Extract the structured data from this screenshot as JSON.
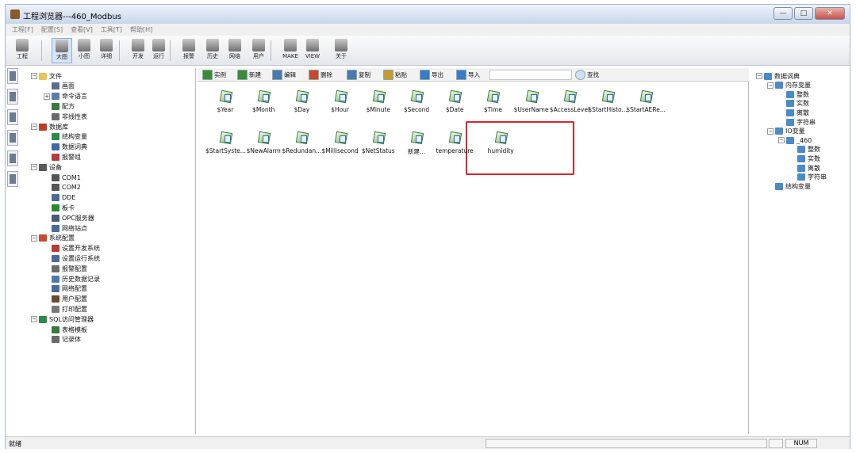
{
  "window": {
    "title": "工程浏览器---460_Modbus"
  },
  "menu": [
    "工程[F]",
    "配置[S]",
    "查看[V]",
    "工具[T]",
    "帮助[H]"
  ],
  "toolbar": [
    {
      "label": "工程",
      "icon": "project-icon"
    },
    {
      "label": "大图",
      "icon": "large-icon-view-icon",
      "active": true
    },
    {
      "label": "小图",
      "icon": "small-icon-view-icon"
    },
    {
      "label": "详细",
      "icon": "detail-view-icon"
    },
    {
      "label": "开发",
      "icon": "develop-icon"
    },
    {
      "label": "运行",
      "icon": "run-icon"
    },
    {
      "label": "报警",
      "icon": "alarm-icon"
    },
    {
      "label": "历史",
      "icon": "history-icon"
    },
    {
      "label": "网络",
      "icon": "network-icon"
    },
    {
      "label": "用户",
      "icon": "user-icon"
    },
    {
      "label": "MAKE",
      "icon": "make-icon"
    },
    {
      "label": "VIEW",
      "icon": "view-icon"
    },
    {
      "label": "关于",
      "icon": "about-icon"
    }
  ],
  "vertical_tabs": [
    "系统",
    "变量",
    "站点",
    "画面",
    "设备",
    "资源"
  ],
  "left_tree": [
    {
      "label": "文件",
      "level": 0,
      "toggle": "−",
      "icon": "folder-icon",
      "color": "#e8c45a"
    },
    {
      "label": "画面",
      "level": 1,
      "icon": "screen-icon",
      "color": "#5a6e8a"
    },
    {
      "label": "命令语言",
      "level": 1,
      "toggle": "+",
      "icon": "command-language-icon",
      "color": "#5a7ab0"
    },
    {
      "label": "配方",
      "level": 1,
      "icon": "recipe-icon",
      "color": "#3c7a3c"
    },
    {
      "label": "非线性表",
      "level": 1,
      "icon": "nonlinear-table-icon",
      "color": "#6a6a6a"
    },
    {
      "label": "数据库",
      "level": 0,
      "toggle": "−",
      "icon": "database-icon",
      "color": "#c03c2a"
    },
    {
      "label": "结构变量",
      "level": 1,
      "icon": "struct-variable-icon",
      "color": "#2e8a4a"
    },
    {
      "label": "数据词典",
      "level": 1,
      "icon": "data-dictionary-icon",
      "color": "#3a6aa8"
    },
    {
      "label": "报警组",
      "level": 1,
      "icon": "alarm-group-icon",
      "color": "#b83a3a"
    },
    {
      "label": "设备",
      "level": 0,
      "toggle": "−",
      "icon": "device-icon",
      "color": "#5a5a5a"
    },
    {
      "label": "COM1",
      "level": 1,
      "icon": "serial-port-icon",
      "color": "#555555"
    },
    {
      "label": "COM2",
      "level": 1,
      "icon": "serial-port-icon",
      "color": "#555555"
    },
    {
      "label": "DDE",
      "level": 1,
      "icon": "dde-icon",
      "color": "#4a6a9a"
    },
    {
      "label": "板卡",
      "level": 1,
      "icon": "board-card-icon",
      "color": "#2a8a2a"
    },
    {
      "label": "OPC服务器",
      "level": 1,
      "icon": "opc-server-icon",
      "color": "#4a5a7a"
    },
    {
      "label": "网络站点",
      "level": 1,
      "icon": "network-station-icon",
      "color": "#4a6a9a"
    },
    {
      "label": "系统配置",
      "level": 0,
      "toggle": "−",
      "icon": "system-config-icon",
      "color": "#c84a2a"
    },
    {
      "label": "设置开发系统",
      "level": 1,
      "icon": "dev-system-icon",
      "color": "#b83a3a"
    },
    {
      "label": "设置运行系统",
      "level": 1,
      "icon": "run-system-icon",
      "color": "#4a6a9a"
    },
    {
      "label": "报警配置",
      "level": 1,
      "icon": "alarm-config-icon",
      "color": "#6a6a6a"
    },
    {
      "label": "历史数据记录",
      "level": 1,
      "icon": "history-record-icon",
      "color": "#4a7ab0"
    },
    {
      "label": "网络配置",
      "level": 1,
      "icon": "network-config-icon",
      "color": "#4a6a9a"
    },
    {
      "label": "用户配置",
      "level": 1,
      "icon": "user-config-icon",
      "color": "#6a4a2a"
    },
    {
      "label": "打印配置",
      "level": 1,
      "icon": "print-config-icon",
      "color": "#7a7a7a"
    },
    {
      "label": "SQL访问管理器",
      "level": 0,
      "toggle": "−",
      "icon": "sql-manager-icon",
      "color": "#2a8a4a"
    },
    {
      "label": "表格模板",
      "level": 1,
      "icon": "table-template-icon",
      "color": "#3a7a3a"
    },
    {
      "label": "记录体",
      "level": 1,
      "icon": "record-icon",
      "color": "#6a6a6a"
    }
  ],
  "right_toolbar": [
    {
      "label": "实例",
      "icon": "instance-icon",
      "color": "#3a8a3a"
    },
    {
      "label": "新建",
      "icon": "new-icon",
      "color": "#3a8a3a"
    },
    {
      "label": "编辑",
      "icon": "edit-icon",
      "color": "#4a7ab0"
    },
    {
      "label": "删除",
      "icon": "delete-icon",
      "color": "#c84a2a"
    },
    {
      "label": "复制",
      "icon": "copy-icon",
      "color": "#4a7ab0"
    },
    {
      "label": "粘贴",
      "icon": "paste-icon",
      "color": "#c89a2a"
    },
    {
      "label": "导出",
      "icon": "export-icon",
      "color": "#3a7ac8"
    },
    {
      "label": "导入",
      "icon": "import-icon",
      "color": "#3a7ac8"
    }
  ],
  "search": {
    "value": "",
    "button_label": "查找"
  },
  "variables": [
    "$Year",
    "$Month",
    "$Day",
    "$Hour",
    "$Minute",
    "$Second",
    "$Date",
    "$Time",
    "$UserName",
    "$AccessLevel",
    "$StartHisto...",
    "$StartAERe...",
    "$StartSyste...",
    "$NewAlarm",
    "$Redundan...",
    "$Millisecond",
    "$NetStatus",
    "新建...",
    "temperature",
    "humidity"
  ],
  "right_tree": [
    {
      "label": "数据词典",
      "level": 0,
      "toggle": "−"
    },
    {
      "label": "内存变量",
      "level": 1,
      "toggle": "−"
    },
    {
      "label": "整数",
      "level": 2
    },
    {
      "label": "实数",
      "level": 2
    },
    {
      "label": "离散",
      "level": 2
    },
    {
      "label": "字符串",
      "level": 2
    },
    {
      "label": "IO变量",
      "level": 1,
      "toggle": "−"
    },
    {
      "label": "_460",
      "level": 2,
      "toggle": "−"
    },
    {
      "label": "整数",
      "level": 3
    },
    {
      "label": "实数",
      "level": 3
    },
    {
      "label": "离散",
      "level": 3
    },
    {
      "label": "字符串",
      "level": 3
    },
    {
      "label": "结构变量",
      "level": 1
    }
  ],
  "status": {
    "text": "就绪",
    "num": "NUM"
  }
}
